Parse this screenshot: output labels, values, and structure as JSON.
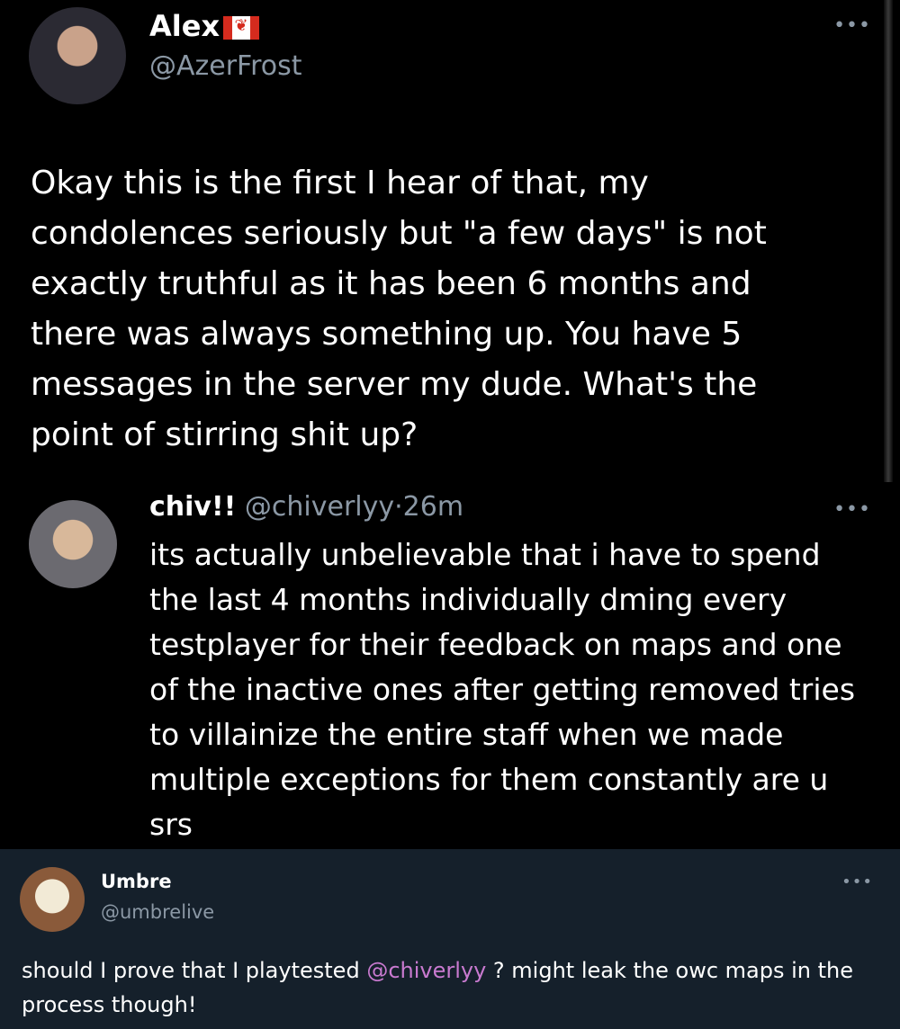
{
  "tweet1": {
    "name": "Alex",
    "flag_icon": "canada-flag-icon",
    "handle": "@AzerFrost",
    "more": "•••",
    "text": "Okay this is the first I hear of that, my condolences seriously but \"a few days\" is not exactly truthful as it has been 6 months and there was always something up. You have 5 messages in the server my dude. What's the point of stirring shit up?"
  },
  "tweet2": {
    "name": "chiv!!",
    "handle": "@chiverlyy",
    "separator": "·",
    "time": "26m",
    "more": "•••",
    "text": "its actually unbelievable that i have to spend the last 4 months individually dming every testplayer for their feedback on maps and one of the inactive ones after getting removed tries to villainize the entire staff when we made multiple exceptions for them constantly are u srs"
  },
  "tweet3": {
    "name": "Umbre",
    "handle": "@umbrelive",
    "more": "•••",
    "text_before": "should I prove that I playtested ",
    "mention": "@chiverlyy",
    "text_after": " ? might leak the owc maps in the process though!"
  }
}
